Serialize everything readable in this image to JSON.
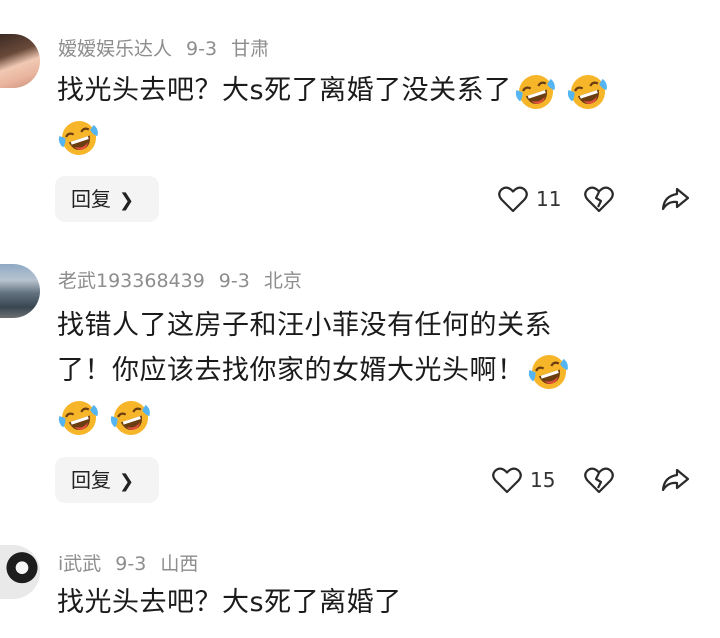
{
  "comments": [
    {
      "user": "嫒嫒娱乐达人",
      "date": "9-3",
      "location": "甘肃",
      "text_line1": "找光头去吧？大s死了离婚了没关系了",
      "reply_label": "回复",
      "likes": "11"
    },
    {
      "user": "老武193368439",
      "date": "9-3",
      "location": "北京",
      "text_line1": "找错人了这房子和汪小菲没有任何的关系",
      "text_line2": "了！你应该去找你家的女婿大光头啊！",
      "reply_label": "回复",
      "likes": "15"
    },
    {
      "user": "i武武",
      "date": "9-3",
      "location": "山西",
      "text_line1": "找光头去吧？大s死了离婚了"
    }
  ],
  "icons": {
    "emoji": "laughing-crying-emoji",
    "like": "heart-outline-icon",
    "dislike": "broken-heart-icon",
    "share": "share-arrow-icon",
    "chevron": "chevron-right-icon"
  },
  "colors": {
    "meta_text": "#8d8d8d",
    "reply_bg": "#f4f4f4",
    "emoji_yellow": "#f7b52a"
  }
}
